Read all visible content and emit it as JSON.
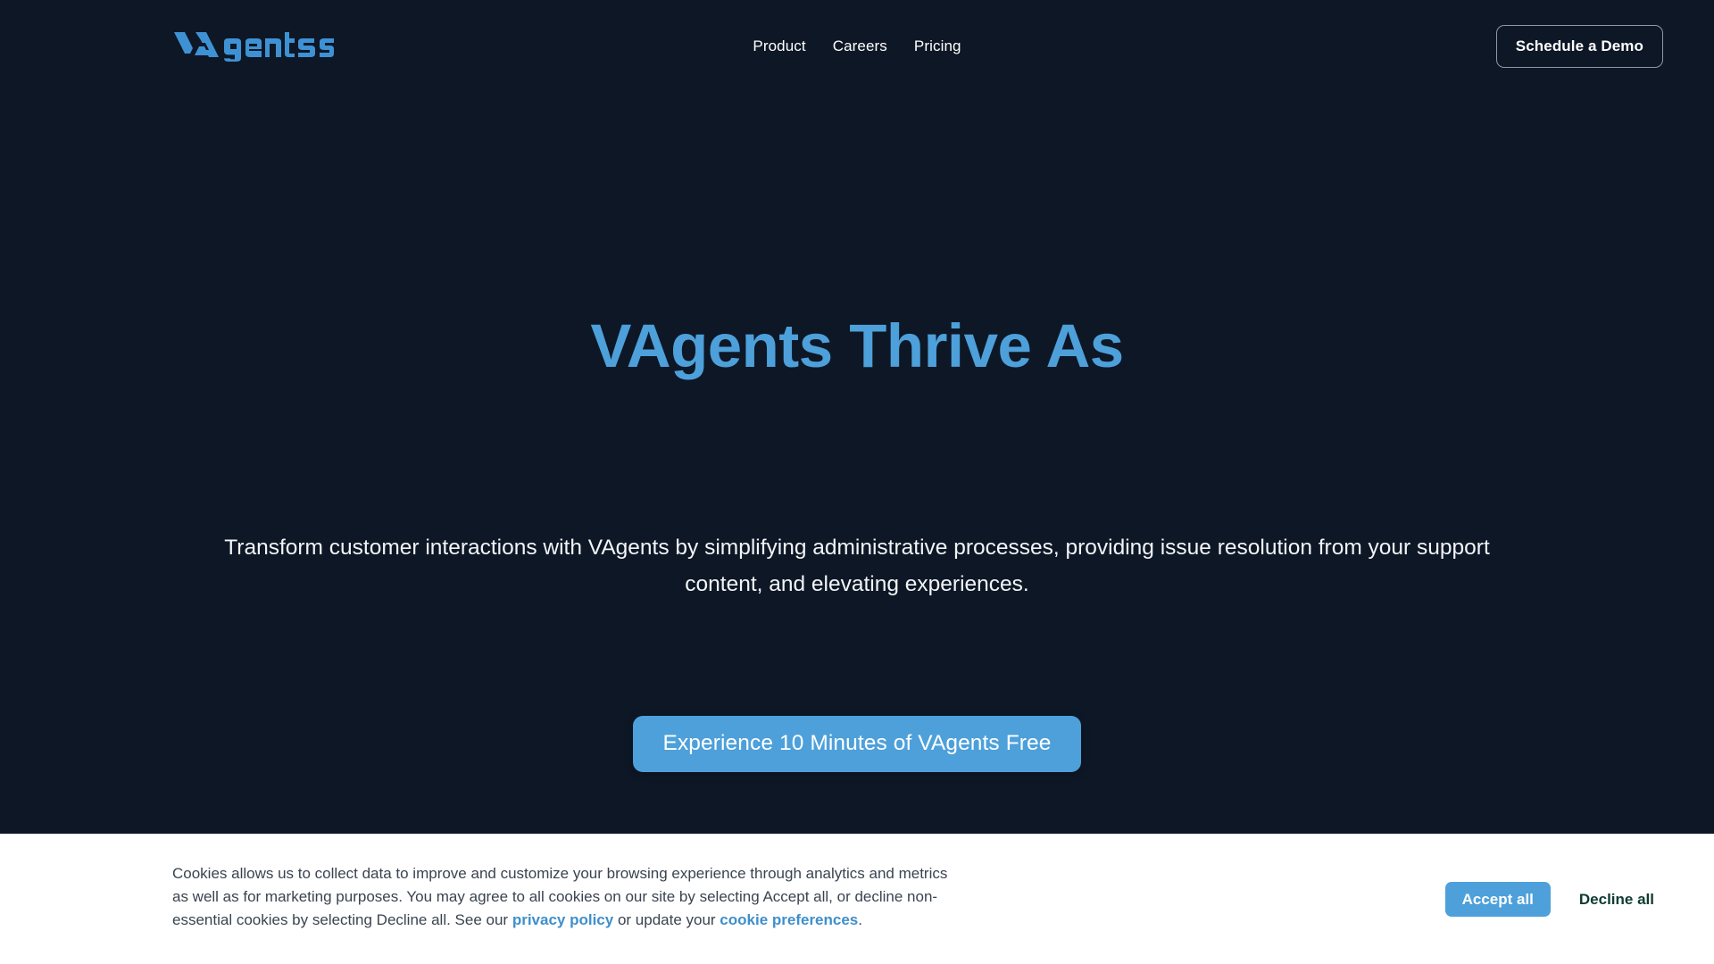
{
  "colors": {
    "background": "#0e1726",
    "accent": "#4da0da",
    "headline": "#4da0da",
    "banner_background": "#ffffff",
    "banner_text": "#3a4450",
    "link": "#3f8fcb",
    "decline_text": "#0f3b30",
    "nav_text": "#ffffff",
    "demo_border": "#8d99a8"
  },
  "header": {
    "brand": {
      "name": "VAgents",
      "icon": "vagents-wordmark-logo"
    },
    "nav": [
      {
        "label": "Product",
        "name": "nav-link-product"
      },
      {
        "label": "Careers",
        "name": "nav-link-careers"
      },
      {
        "label": "Pricing",
        "name": "nav-link-pricing"
      }
    ],
    "demo_button": "Schedule a Demo"
  },
  "hero": {
    "title": "VAgents Thrive As",
    "subtitle": "Transform customer interactions with VAgents by simplifying administrative processes, providing issue resolution from your support content, and elevating experiences.",
    "cta_label": "Experience 10 Minutes of VAgents Free"
  },
  "cookie_banner": {
    "text_part_1": "Cookies allows us to collect data to improve and customize your browsing experience through analytics and metrics as well as for marketing purposes. You may agree to all cookies on our site by selecting Accept all, or decline non-essential cookies by selecting Decline all. See our ",
    "link_privacy": "privacy policy",
    "text_part_2": " or update your ",
    "link_preferences": "cookie preferences",
    "text_part_3": ".",
    "accept_label": "Accept all",
    "decline_label": "Decline all"
  }
}
